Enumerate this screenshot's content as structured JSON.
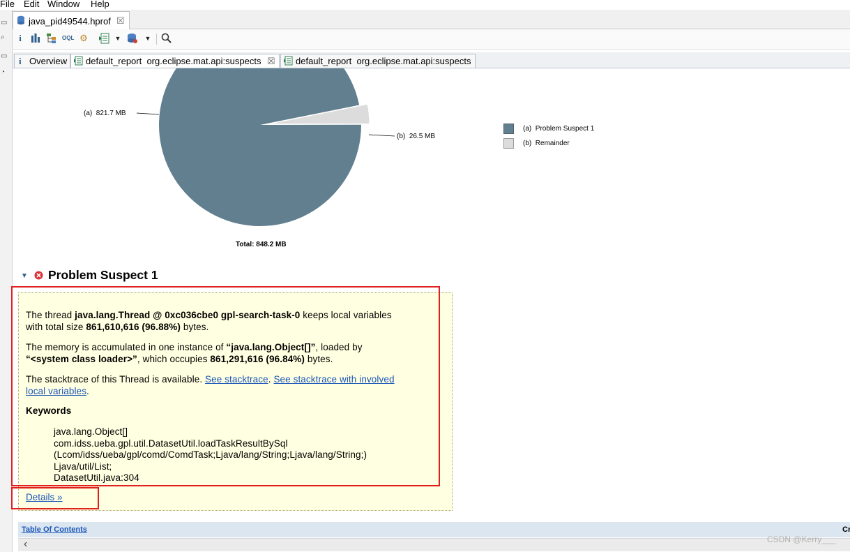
{
  "menu": [
    "File",
    "Edit",
    "Window",
    "Help"
  ],
  "editor_tab": {
    "label": "java_pid49544.hprof",
    "close": "☒"
  },
  "toolbar": {
    "icons": [
      "info-icon",
      "histogram-icon",
      "dominator-tree-icon",
      "oql-icon",
      "thread-overview-icon",
      "reports-dropdown-icon",
      "query-browser-icon",
      "search-icon"
    ]
  },
  "report_tabs": [
    {
      "icon": "i",
      "label": "Overview"
    },
    {
      "label": "default_report  org.eclipse.mat.api:suspects",
      "close": "☒"
    },
    {
      "label": "default_report  org.eclipse.mat.api:suspects"
    }
  ],
  "chart_data": {
    "type": "pie",
    "title": "",
    "total_label": "Total: 848.2 MB",
    "slices": [
      {
        "key": "(a)",
        "name": "Problem Suspect 1",
        "label": "821.7 MB",
        "value": 821.7,
        "color": "#617f8f"
      },
      {
        "key": "(b)",
        "name": "Remainder",
        "label": "26.5 MB",
        "value": 26.5,
        "color": "#dcdcdc"
      }
    ],
    "legend_position": "right"
  },
  "suspect": {
    "title": "Problem Suspect 1",
    "p1_pre": "The thread ",
    "p1_bold": "java.lang.Thread @ 0xc036cbe0 gpl-search-task-0",
    "p1_mid": " keeps local variables",
    "p1_line2_pre": "with total size ",
    "p1_size": "861,610,616 (96.88%)",
    "p1_post": " bytes.",
    "p2_pre": "The memory is accumulated in one instance of ",
    "p2_class": "“java.lang.Object[]”",
    "p2_mid": ", loaded by",
    "p2_loader": "“<system class loader>”",
    "p2_mid2": ", which occupies ",
    "p2_size": "861,291,616 (96.84%)",
    "p2_post": " bytes.",
    "p3_pre": "The stacktrace of this Thread is available. ",
    "p3_link1": "See stacktrace",
    "p3_sep": ". ",
    "p3_link2a": "See stacktrace with involved",
    "p3_link2b": "local variables",
    "p3_post": ".",
    "keywords_title": "Keywords",
    "keywords": [
      "java.lang.Object[]",
      "com.idss.ueba.gpl.util.DatasetUtil.loadTaskResultBySql",
      "(Lcom/idss/ueba/gpl/comd/ComdTask;Ljava/lang/String;Ljava/lang/String;)",
      "Ljava/util/List;",
      "DatasetUtil.java:304"
    ],
    "details_link": "Details »"
  },
  "toc": {
    "label": "Table Of Contents",
    "right": "Cr"
  },
  "watermark": "CSDN @Kerry___",
  "colors": {
    "highlight_red": "#e0201e",
    "link": "#1a56b8",
    "box_bg": "#ffffe1"
  }
}
